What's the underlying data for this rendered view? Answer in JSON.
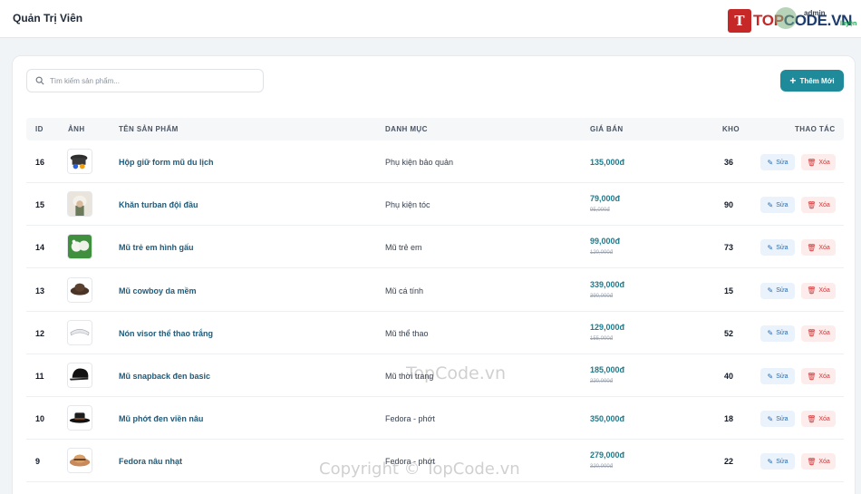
{
  "header": {
    "title": "Quản Trị Viên",
    "logo_mark": "T",
    "logo_word_1": "TOP",
    "logo_word_2": "CODE.VN",
    "admin_label": "admin",
    "luyen_label": "luyện"
  },
  "toolbar": {
    "search_placeholder": "Tìm kiếm sản phẩm...",
    "add_label": "Thêm Mới"
  },
  "table": {
    "columns": [
      "ID",
      "ẢNH",
      "TÊN SẢN PHẨM",
      "DANH MỤC",
      "GIÁ BÁN",
      "KHO",
      "THAO TÁC"
    ],
    "edit_label": "Sửa",
    "delete_label": "Xóa",
    "rows": [
      {
        "id": "16",
        "name": "Hộp giữ form mũ du lịch",
        "category": "Phụ kiện bảo quản",
        "price": "135,000đ",
        "old_price": "",
        "stock": "36",
        "thumb": "hat-box"
      },
      {
        "id": "15",
        "name": "Khăn turban đội đầu",
        "category": "Phụ kiện tóc",
        "price": "79,000đ",
        "old_price": "95,000đ",
        "stock": "90",
        "thumb": "turban"
      },
      {
        "id": "14",
        "name": "Mũ trẻ em hình gấu",
        "category": "Mũ trẻ em",
        "price": "99,000đ",
        "old_price": "120,000đ",
        "stock": "73",
        "thumb": "bear-hat"
      },
      {
        "id": "13",
        "name": "Mũ cowboy da mềm",
        "category": "Mũ cá tính",
        "price": "339,000đ",
        "old_price": "390,000đ",
        "stock": "15",
        "thumb": "cowboy-hat"
      },
      {
        "id": "12",
        "name": "Nón visor thể thao trắng",
        "category": "Mũ thể thao",
        "price": "129,000đ",
        "old_price": "155,000đ",
        "stock": "52",
        "thumb": "visor"
      },
      {
        "id": "11",
        "name": "Mũ snapback đen basic",
        "category": "Mũ thời trang",
        "price": "185,000đ",
        "old_price": "220,000đ",
        "stock": "40",
        "thumb": "snapback"
      },
      {
        "id": "10",
        "name": "Mũ phớt đen viền nâu",
        "category": "Fedora - phớt",
        "price": "350,000đ",
        "old_price": "",
        "stock": "18",
        "thumb": "black-fedora"
      },
      {
        "id": "9",
        "name": "Fedora nâu nhạt",
        "category": "Fedora - phớt",
        "price": "279,000đ",
        "old_price": "320,000đ",
        "stock": "22",
        "thumb": "straw-fedora"
      }
    ]
  },
  "watermarks": {
    "top": "TopCode.vn",
    "bottom": "Copyright © TopCode.vn"
  },
  "colors": {
    "accent": "#1f8a99",
    "price": "#1f7a8c",
    "name": "#1e5a7a",
    "edit": "#2b6cb0",
    "delete": "#d03535"
  }
}
